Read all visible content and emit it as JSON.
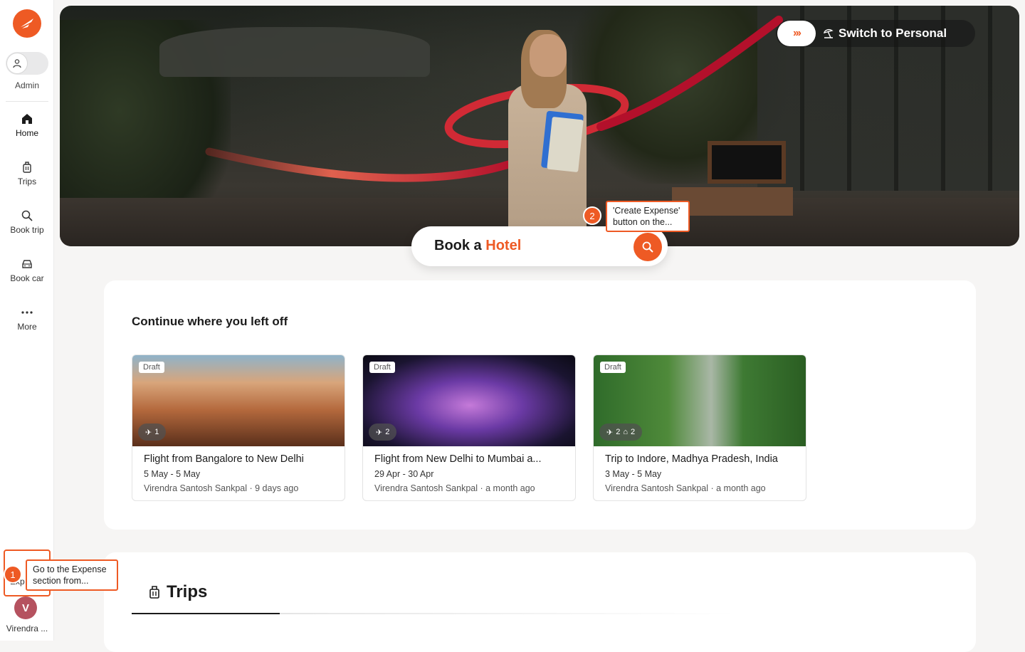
{
  "sidebar": {
    "role_label": "Admin",
    "items": [
      {
        "label": "Home",
        "icon": "home-icon"
      },
      {
        "label": "Trips",
        "icon": "luggage-icon"
      },
      {
        "label": "Book trip",
        "icon": "search-icon"
      },
      {
        "label": "Book car",
        "icon": "car-icon"
      },
      {
        "label": "More",
        "icon": "more-dots-icon"
      }
    ],
    "expense_label_partial": "Exp",
    "user_initial": "V",
    "user_name": "Virendra ..."
  },
  "hero": {
    "switch_arrows": "›››",
    "switch_label": "Switch to Personal"
  },
  "search": {
    "prefix": "Book a",
    "accent": "Hotel"
  },
  "tooltips": {
    "one_number": "1",
    "one_text": "Go to the Expense section from...",
    "two_number": "2",
    "two_text": "'Create Expense' button on the..."
  },
  "continue": {
    "title": "Continue where you left off",
    "cards": [
      {
        "badge": "Draft",
        "counts": "1",
        "title": "Flight from Bangalore to New Delhi",
        "dates": "5 May - 5 May",
        "meta": "Virendra Santosh Sankpal · 9 days ago"
      },
      {
        "badge": "Draft",
        "counts": "2",
        "title": "Flight from New Delhi to Mumbai a...",
        "dates": "29 Apr - 30 Apr",
        "meta": "Virendra Santosh Sankpal · a month ago"
      },
      {
        "badge": "Draft",
        "counts": "2",
        "counts2": "2",
        "title": "Trip to Indore, Madhya Pradesh, India",
        "dates": "3 May - 5 May",
        "meta": "Virendra Santosh Sankpal · a month ago"
      }
    ]
  },
  "trips_section": {
    "heading": "Trips"
  },
  "colors": {
    "accent": "#ee5a24",
    "avatar": "#b5525f"
  }
}
